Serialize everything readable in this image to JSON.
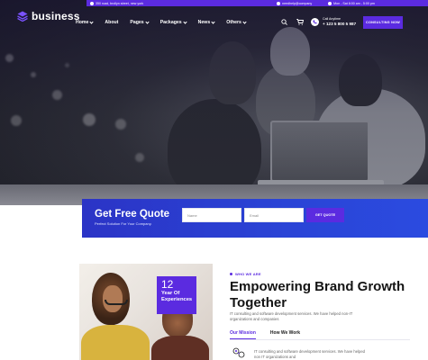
{
  "topbar": {
    "address": "350 road, brollyn street, new york",
    "email": "needhelp@company",
    "hours": "Mon - Sat 8:00 am - 5:00 pm"
  },
  "brand": {
    "name": "business"
  },
  "nav": {
    "items": [
      {
        "label": "Home",
        "dropdown": true
      },
      {
        "label": "About",
        "dropdown": false
      },
      {
        "label": "Pages",
        "dropdown": true
      },
      {
        "label": "Packages",
        "dropdown": true
      },
      {
        "label": "News",
        "dropdown": true
      },
      {
        "label": "Others",
        "dropdown": true
      }
    ],
    "call_label": "Call Anytime",
    "call_number": "+ 123 5 800 5 987",
    "consult_button": "CONSULTING NOW"
  },
  "quote": {
    "title": "Get Free Quote",
    "subtitle": "Perfect Solution For Your Company.",
    "name_placeholder": "Name",
    "email_placeholder": "Email",
    "button": "GET QUOTE"
  },
  "about": {
    "experience_number": "12",
    "experience_text": "Year Of Experiences",
    "eyebrow": "WHO WE ARE",
    "heading": "Empowering Brand Growth Together",
    "description": "IT consulting and software development services. We have helped non-IT organizations and companies",
    "tabs": [
      {
        "label": "Our Mission",
        "active": true
      },
      {
        "label": "How We Work",
        "active": false
      }
    ],
    "mission_text": "IT consulting and software development services. We have helped non IT organizations and"
  },
  "colors": {
    "accent": "#5b2be0",
    "quote_bar": "#2b44d6",
    "heading": "#141414"
  },
  "icons": [
    "location-icon",
    "email-icon",
    "clock-icon",
    "search-icon",
    "cart-icon",
    "phone-icon",
    "mission-icon"
  ]
}
